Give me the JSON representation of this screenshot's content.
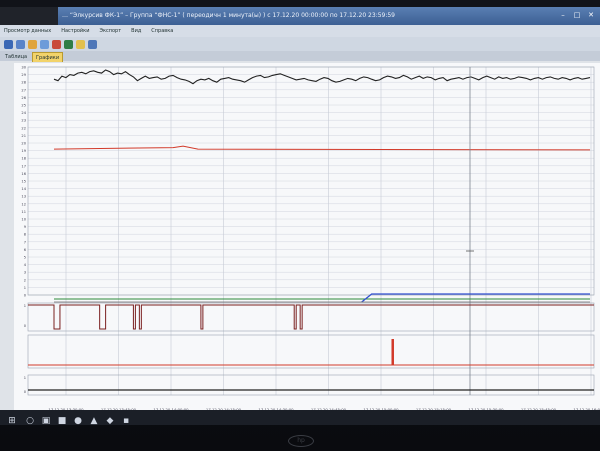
{
  "window": {
    "title": "… “Элкурсив ФК-1” – Группа “ФНС-1” ( переодичн 1 минута(ы) ) с 17.12.20 00:00:00 по 17.12.20 23:59:59"
  },
  "menu": {
    "items": [
      "Просмотр данных",
      "Настройки",
      "Экспорт",
      "Вид",
      "Справка"
    ]
  },
  "tabs": [
    {
      "label": "Таблица"
    },
    {
      "label": "Графики"
    }
  ],
  "chart": {
    "y_labels_upper": [
      "30",
      "29",
      "28",
      "27",
      "26",
      "25",
      "24",
      "23",
      "22",
      "21",
      "20",
      "19",
      "18",
      "17",
      "16",
      "15",
      "14",
      "13",
      "12",
      "11",
      "10",
      "9",
      "8",
      "7",
      "6",
      "5",
      "4",
      "3",
      "2",
      "1",
      "0"
    ],
    "y_labels_lower": [
      "1",
      "0"
    ],
    "y_labels_bottom": [
      "1",
      "0"
    ],
    "x_labels": [
      "17.12.20 13:30:00",
      "17.12.20 13:45:00",
      "17.12.20 14:00:00",
      "17.12.20 14:15:00",
      "17.12.20 14:30:00",
      "17.12.20 14:45:00",
      "17.12.20 15:00:00",
      "17.12.20 15:15:00",
      "17.12.20 15:30:00",
      "17.12.20 15:45:00",
      "17.12.20 16:00:00"
    ],
    "colors": {
      "black": "#222222",
      "red": "#d23a2a",
      "blue": "#2f4fd0",
      "green": "#2e8a3a",
      "grid": "#c6ccd6"
    }
  },
  "chart_data": [
    {
      "type": "line",
      "x": [
        0,
        4,
        8,
        12,
        16,
        20,
        24,
        28,
        32,
        36,
        40,
        44,
        48,
        52,
        56,
        60,
        64,
        68,
        72,
        76,
        80,
        84,
        88,
        92,
        96,
        100,
        104,
        108,
        112,
        116,
        120,
        124,
        128,
        132,
        136,
        140,
        144,
        148,
        152,
        156,
        160,
        164,
        168,
        172,
        176,
        180,
        184,
        188,
        192,
        196,
        200,
        204,
        208,
        212,
        216,
        220,
        224,
        228,
        232,
        236,
        240,
        244,
        248,
        252,
        256,
        260,
        264,
        268,
        272,
        276,
        280,
        284,
        288,
        292,
        296,
        300,
        304,
        308,
        312,
        316,
        320,
        324,
        328,
        332,
        336,
        340,
        344,
        348,
        352,
        356,
        360,
        364,
        368,
        372,
        376,
        380,
        384,
        388,
        392,
        396,
        400,
        404,
        408,
        412,
        416,
        420,
        424,
        428,
        432,
        436,
        440,
        444,
        448,
        452,
        456,
        460,
        464,
        468,
        472,
        476,
        480,
        484,
        488,
        492,
        496,
        500,
        504,
        508,
        512,
        516,
        520,
        524,
        528,
        532,
        536,
        540
      ],
      "y_black": [
        28.4,
        28.2,
        28.8,
        28.6,
        29.0,
        28.9,
        29.2,
        29.3,
        29.1,
        29.4,
        29.5,
        29.3,
        29.2,
        29.6,
        29.4,
        29.0,
        29.2,
        29.1,
        29.4,
        29.0,
        28.7,
        28.2,
        28.5,
        28.8,
        28.5,
        28.6,
        28.7,
        28.4,
        28.5,
        28.8,
        28.9,
        28.6,
        28.4,
        28.3,
        28.1,
        27.8,
        28.2,
        28.4,
        28.3,
        28.5,
        28.2,
        28.0,
        28.4,
        28.5,
        28.6,
        28.4,
        28.3,
        28.2,
        28.0,
        28.3,
        28.6,
        28.8,
        28.9,
        28.6,
        28.7,
        28.9,
        29.0,
        29.1,
        28.9,
        28.7,
        28.5,
        28.3,
        28.4,
        28.5,
        28.3,
        28.2,
        28.1,
        28.4,
        28.6,
        28.5,
        28.2,
        28.0,
        28.1,
        28.3,
        28.5,
        28.4,
        28.2,
        28.5,
        28.7,
        28.6,
        28.4,
        28.2,
        28.3,
        28.6,
        28.8,
        28.7,
        28.5,
        28.6,
        28.9,
        28.7,
        28.4,
        28.6,
        28.8,
        28.5,
        28.7,
        28.6,
        28.3,
        28.5,
        28.6,
        28.2,
        28.4,
        28.5,
        28.6,
        28.4,
        28.6,
        28.7,
        28.5,
        28.3,
        28.6,
        28.8,
        28.6,
        28.4,
        28.7,
        28.5,
        28.6,
        28.4,
        28.5,
        28.7,
        28.6,
        28.5,
        28.3,
        28.5,
        28.6,
        28.4,
        28.6,
        28.7,
        28.5,
        28.4,
        28.6,
        28.5,
        28.3,
        28.5,
        28.6,
        28.4,
        28.5,
        28.6
      ],
      "y_red_avg": 19.2,
      "ylim": [
        0,
        30
      ]
    }
  ]
}
